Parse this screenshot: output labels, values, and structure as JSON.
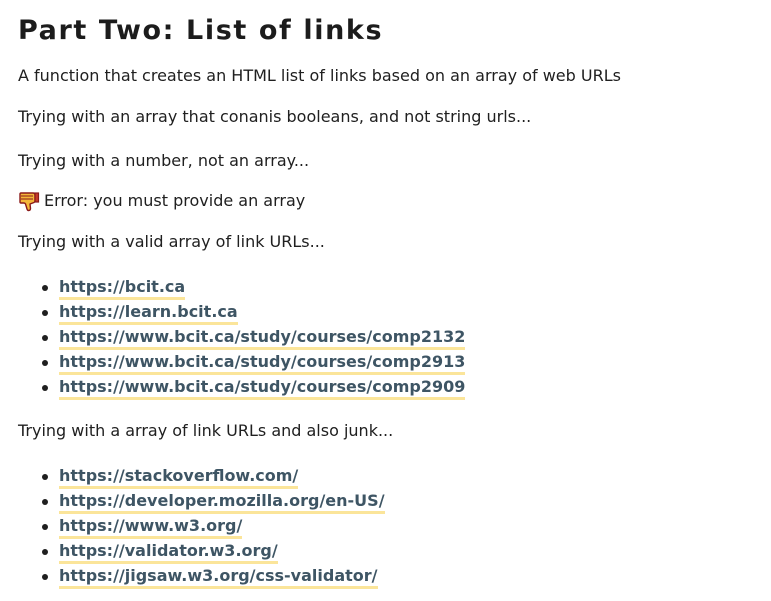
{
  "title": "Part Two: List of links",
  "description": "A function that creates an HTML list of links based on an array of web URLs",
  "test_booleans": "Trying with an array that conanis booleans, and not string urls...",
  "test_number": "Trying with a number, not an array...",
  "error": {
    "icon": "thumbs-down-icon",
    "message": "Error: you must provide an array"
  },
  "test_valid": "Trying with a valid array of link URLs...",
  "valid_links": [
    "https://bcit.ca",
    "https://learn.bcit.ca",
    "https://www.bcit.ca/study/courses/comp2132",
    "https://www.bcit.ca/study/courses/comp2913",
    "https://www.bcit.ca/study/courses/comp2909"
  ],
  "test_junk": "Trying with a array of link URLs and also junk...",
  "junk_links": [
    "https://stackoverflow.com/",
    "https://developer.mozilla.org/en-US/",
    "https://www.w3.org/",
    "https://validator.w3.org/",
    "https://jigsaw.w3.org/css-validator/"
  ],
  "colors": {
    "link": "#3e5564",
    "link_underline": "#fbe59a",
    "text": "#202020",
    "icon_fill": "#f4b73a",
    "icon_outline": "#8a1a1a"
  }
}
